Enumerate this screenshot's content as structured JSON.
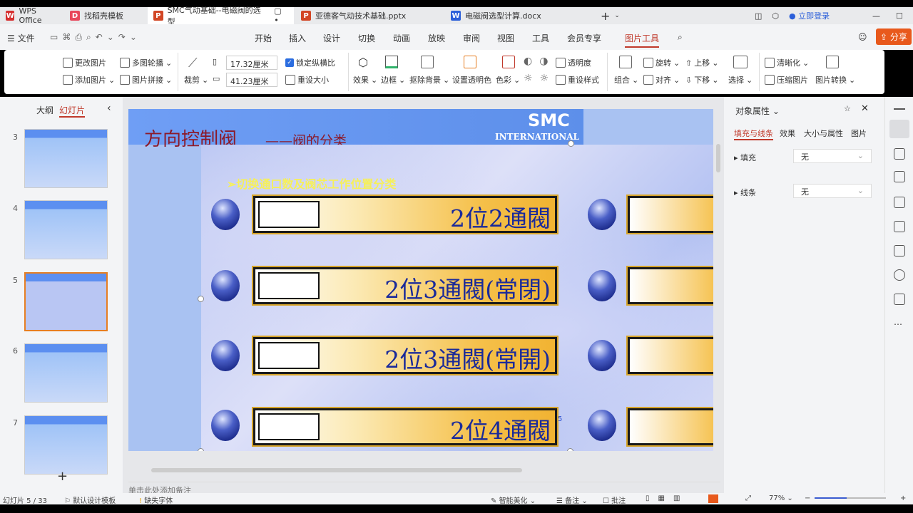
{
  "tabs": [
    {
      "label": "WPS Office",
      "badge": "W",
      "color": "#d62f2f"
    },
    {
      "label": "找稻壳模板",
      "badge": "D",
      "color": "#e8475b"
    },
    {
      "label": "SMC气动基础--电磁阀的选型",
      "badge": "P",
      "color": "#d24625",
      "active": true
    },
    {
      "label": "亚德客气动技术基础.pptx",
      "badge": "P",
      "color": "#d24625"
    },
    {
      "label": "电磁阀选型计算.docx",
      "badge": "W",
      "color": "#2b5fd9"
    }
  ],
  "title_right": {
    "login": "立即登录"
  },
  "menu": {
    "file": "文件",
    "items": [
      "开始",
      "插入",
      "设计",
      "切换",
      "动画",
      "放映",
      "审阅",
      "视图",
      "工具",
      "会员专享",
      "图片工具"
    ],
    "active": "图片工具",
    "share": "分享"
  },
  "ribbon": {
    "change_pic": "更改图片",
    "multi_carousel": "多图轮播",
    "add_pic": "添加图片",
    "pic_splice": "图片拼接",
    "crop": "裁剪",
    "width": "17.32厘米",
    "height": "41.23厘米",
    "lock_ratio": "锁定纵横比",
    "reset_size": "重设大小",
    "effects": "效果",
    "border": "边框",
    "remove_bg": "抠除背景",
    "set_transparent": "设置透明色",
    "color": "色彩",
    "transparency": "透明度",
    "reset_style": "重设样式",
    "group": "组合",
    "rotate": "旋转",
    "align": "对齐",
    "move_up": "上移",
    "move_down": "下移",
    "select": "选择",
    "sharpen": "清晰化",
    "compress": "压缩图片",
    "convert": "图片转换"
  },
  "left_panel": {
    "tab_outline": "大纲",
    "tab_slides": "幻灯片",
    "slides": [
      "3",
      "4",
      "5",
      "6",
      "7"
    ],
    "selected": "5",
    "add": "+"
  },
  "slide": {
    "title": "方向控制阀",
    "subtitle": "——阀的分类",
    "logo_text": "SMC",
    "logo_sub": "INTERNATIONAL",
    "heading": "➢切换通口数及阀芯工作位置分类",
    "rows": [
      "2位2通閥",
      "2位3通閥(常閉)",
      "2位3通閥(常開)",
      "2位4通閥"
    ],
    "page_num": "5"
  },
  "notes_placeholder": "单击此处添加备注",
  "right_panel": {
    "title": "对象属性",
    "tabs": [
      "填充与线条",
      "效果",
      "大小与属性",
      "图片"
    ],
    "active_tab": "填充与线条",
    "fill_label": "填充",
    "fill_value": "无",
    "line_label": "线条",
    "line_value": "无"
  },
  "status": {
    "slide_count": "幻灯片 5 / 33",
    "theme": "默认设计模板",
    "missing_font": "缺失字体",
    "beautify": "智能美化",
    "notes": "备注",
    "comments": "批注",
    "zoom": "77%"
  }
}
